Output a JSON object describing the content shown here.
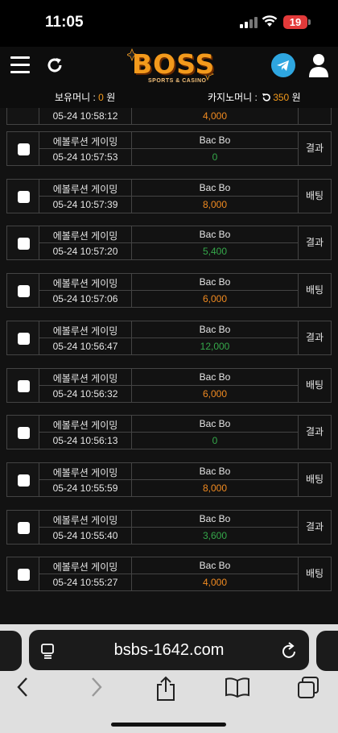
{
  "status_bar": {
    "time": "11:05",
    "battery": "19"
  },
  "header": {
    "logo_text": "BOSS",
    "logo_sub": "SPORTS & CASINO"
  },
  "balance": {
    "holding_label": "보유머니 : ",
    "holding_value": "0",
    "holding_unit": " 원",
    "casino_label": "카지노머니 : ",
    "casino_value": "350",
    "casino_unit": " 원"
  },
  "partial_row": {
    "time": "05-24 10:58:12",
    "amount": "4,000"
  },
  "rows": [
    {
      "game": "에볼루션 게이밍",
      "title": "Bac Bo",
      "time": "05-24 10:57:53",
      "amount": "0",
      "amount_color": "green",
      "type": "결과"
    },
    {
      "game": "에볼루션 게이밍",
      "title": "Bac Bo",
      "time": "05-24 10:57:39",
      "amount": "8,000",
      "amount_color": "orange",
      "type": "배팅"
    },
    {
      "game": "에볼루션 게이밍",
      "title": "Bac Bo",
      "time": "05-24 10:57:20",
      "amount": "5,400",
      "amount_color": "green",
      "type": "결과"
    },
    {
      "game": "에볼루션 게이밍",
      "title": "Bac Bo",
      "time": "05-24 10:57:06",
      "amount": "6,000",
      "amount_color": "orange",
      "type": "배팅"
    },
    {
      "game": "에볼루션 게이밍",
      "title": "Bac Bo",
      "time": "05-24 10:56:47",
      "amount": "12,000",
      "amount_color": "green",
      "type": "결과"
    },
    {
      "game": "에볼루션 게이밍",
      "title": "Bac Bo",
      "time": "05-24 10:56:32",
      "amount": "6,000",
      "amount_color": "orange",
      "type": "배팅"
    },
    {
      "game": "에볼루션 게이밍",
      "title": "Bac Bo",
      "time": "05-24 10:56:13",
      "amount": "0",
      "amount_color": "green",
      "type": "결과"
    },
    {
      "game": "에볼루션 게이밍",
      "title": "Bac Bo",
      "time": "05-24 10:55:59",
      "amount": "8,000",
      "amount_color": "orange",
      "type": "배팅"
    },
    {
      "game": "에볼루션 게이밍",
      "title": "Bac Bo",
      "time": "05-24 10:55:40",
      "amount": "3,600",
      "amount_color": "green",
      "type": "결과"
    },
    {
      "game": "에볼루션 게이밍",
      "title": "Bac Bo",
      "time": "05-24 10:55:27",
      "amount": "4,000",
      "amount_color": "orange",
      "type": "배팅"
    }
  ],
  "browser": {
    "url": "bsbs-1642.com"
  },
  "colors": {
    "accent": "#f39a1c",
    "win_green": "#35a84a",
    "bet_orange": "#f08a20",
    "telegram": "#2ea6e0"
  }
}
